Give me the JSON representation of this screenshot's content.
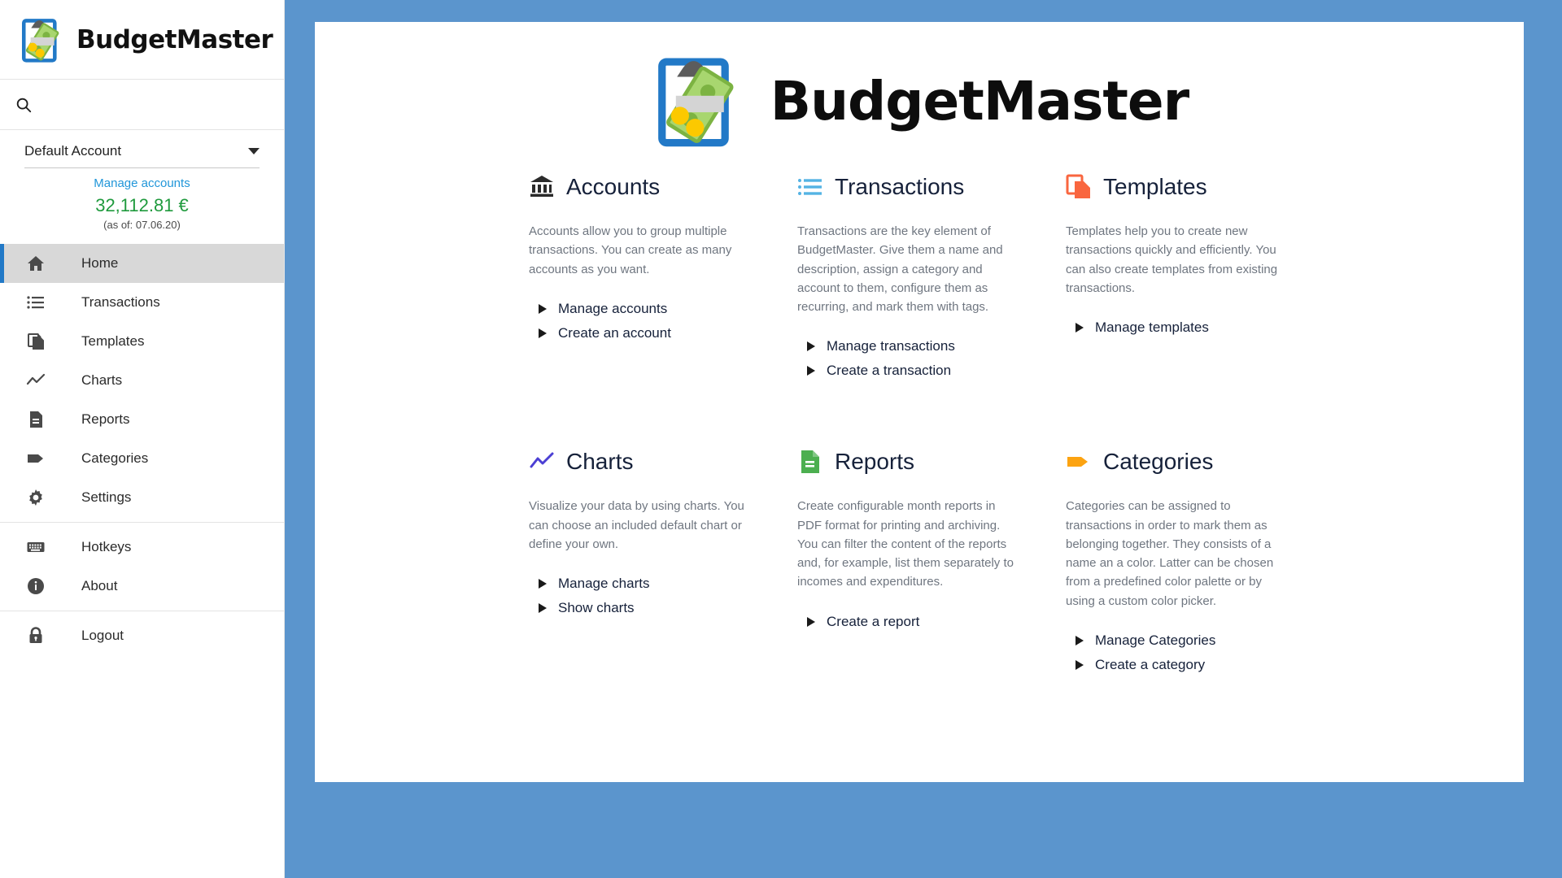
{
  "sidebar": {
    "brand": {
      "name": "BudgetMaster",
      "logo_icon": "clipboard-money-icon"
    },
    "search": {
      "placeholder": "",
      "value": "",
      "icon": "search-icon"
    },
    "account": {
      "selected": "Default Account",
      "dropdown_icon": "chevron-down-icon",
      "manage_accounts_label": "Manage accounts",
      "balance": "32,112.81 €",
      "balance_color": "#1f9a3d",
      "as_of": "(as of: 07.06.20)"
    },
    "nav": [
      {
        "label": "Home",
        "icon": "home-icon",
        "active": true
      },
      {
        "label": "Transactions",
        "icon": "list-icon",
        "active": false
      },
      {
        "label": "Templates",
        "icon": "copy-icon",
        "active": false
      },
      {
        "label": "Charts",
        "icon": "line-chart-icon",
        "active": false
      },
      {
        "label": "Reports",
        "icon": "document-icon",
        "active": false
      },
      {
        "label": "Categories",
        "icon": "tag-icon",
        "active": false
      },
      {
        "label": "Settings",
        "icon": "gear-icon",
        "active": false
      },
      {
        "label": "Hotkeys",
        "icon": "keyboard-icon",
        "active": false
      },
      {
        "label": "About",
        "icon": "info-icon",
        "active": false
      },
      {
        "label": "Logout",
        "icon": "lock-icon",
        "active": false
      }
    ]
  },
  "main": {
    "hero": {
      "title": "BudgetMaster",
      "logo_icon": "clipboard-money-icon"
    },
    "features": [
      {
        "title": "Accounts",
        "icon": "bank-icon",
        "icon_color": "#2b2b2b",
        "description": "Accounts allow you to group multiple transactions. You can create as many accounts as you want.",
        "links": [
          "Manage accounts",
          "Create an account"
        ]
      },
      {
        "title": "Transactions",
        "icon": "list-blue-icon",
        "icon_color": "#54b3e4",
        "description": "Transactions are the key element of BudgetMaster. Give them a name and description, assign a category and account to them, configure them as recurring, and mark them with tags.",
        "links": [
          "Manage transactions",
          "Create a transaction"
        ]
      },
      {
        "title": "Templates",
        "icon": "copy-orange-icon",
        "icon_color": "#f9663f",
        "description": "Templates help you to create new transactions quickly and efficiently. You can also create templates from existing transactions.",
        "links": [
          "Manage templates"
        ]
      },
      {
        "title": "Charts",
        "icon": "line-chart-purple-icon",
        "icon_color": "#4b3fd4",
        "description": "Visualize your data by using charts. You can choose an included default chart or define your own.",
        "links": [
          "Manage charts",
          "Show charts"
        ]
      },
      {
        "title": "Reports",
        "icon": "document-green-icon",
        "icon_color": "#4caf50",
        "description": "Create configurable month reports in PDF format for printing and archiving. You can filter the content of the reports and, for example, list them separately to incomes and expenditures.",
        "links": [
          "Create a report"
        ]
      },
      {
        "title": "Categories",
        "icon": "tag-orange-icon",
        "icon_color": "#fca311",
        "description": "Categories can be assigned to transactions in order to mark them as belonging together. They consists of a name an a color. Latter can be chosen from a predefined color palette or by using a custom color picker.",
        "links": [
          "Manage Categories",
          "Create a category"
        ]
      }
    ]
  },
  "colors": {
    "page_background": "#5b95cd",
    "accent_blue": "#2279c7",
    "link_blue": "#2196d9",
    "balance_green": "#1f9a3d"
  }
}
